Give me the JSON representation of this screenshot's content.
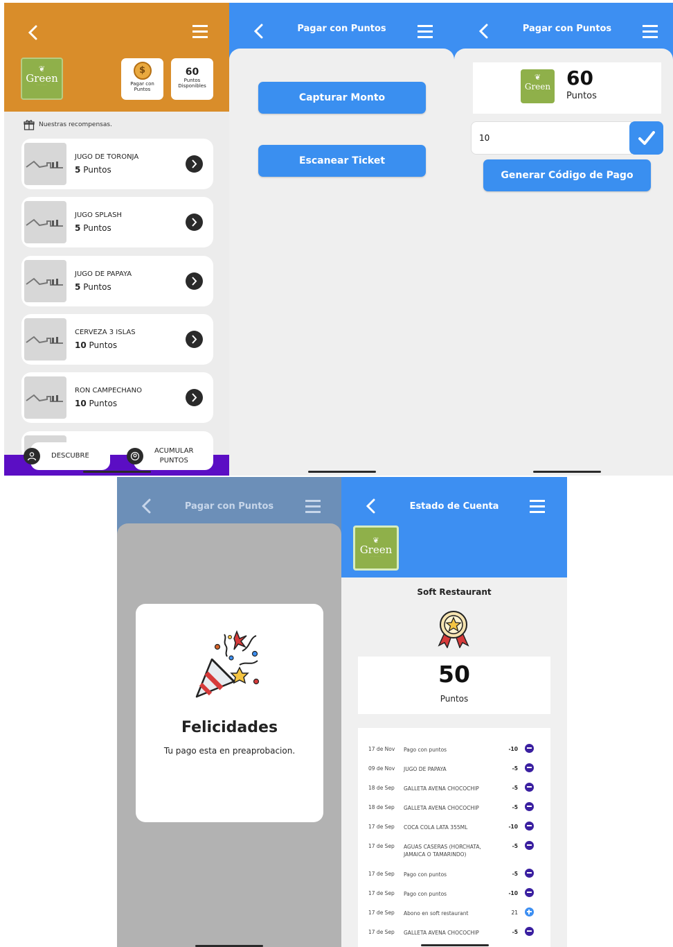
{
  "screen1": {
    "pay_card_label": "Pagar con Puntos",
    "points_value": "60",
    "points_label": "Puntos Disponibles",
    "rewards_title": "Nuestras recompensas.",
    "rewards": [
      {
        "name": "JUGO DE TORONJA",
        "points": "5",
        "unit": "Puntos"
      },
      {
        "name": "JUGO SPLASH",
        "points": "5",
        "unit": "Puntos"
      },
      {
        "name": "JUGO DE PAPAYA",
        "points": "5",
        "unit": "Puntos"
      },
      {
        "name": "CERVEZA 3 ISLAS",
        "points": "10",
        "unit": "Puntos"
      },
      {
        "name": "RON CAMPECHANO",
        "points": "10",
        "unit": "Puntos"
      }
    ],
    "tabs": {
      "discover": "DESCUBRE",
      "accumulate_line1": "ACUMULAR",
      "accumulate_line2": "PUNTOS"
    },
    "logo_text": "Green"
  },
  "screen2": {
    "title": "Pagar con Puntos",
    "capture_button": "Capturar Monto",
    "scan_button": "Escanear Ticket"
  },
  "screen3": {
    "title": "Pagar con Puntos",
    "balance_value": "60",
    "balance_label": "Puntos",
    "amount_value": "10",
    "generate_button": "Generar Código de Pago",
    "logo_text": "Green"
  },
  "screen4": {
    "title": "Pagar con Puntos",
    "modal_title": "Felicidades",
    "modal_text": "Tu pago esta en preaprobacion."
  },
  "screen5": {
    "title": "Estado de Cuenta",
    "logo_text": "Green",
    "restaurant_name": "Soft Restaurant",
    "points_value": "50",
    "points_label": "Puntos",
    "transactions": [
      {
        "date": "17 de Nov",
        "concept": "Pago con puntos",
        "amount": "-10",
        "kind": "minus"
      },
      {
        "date": "09 de Nov",
        "concept": "JUGO DE PAPAYA",
        "amount": "-5",
        "kind": "minus"
      },
      {
        "date": "18 de Sep",
        "concept": "GALLETA AVENA CHOCOCHIP",
        "amount": "-5",
        "kind": "minus"
      },
      {
        "date": "18 de Sep",
        "concept": "GALLETA AVENA CHOCOCHIP",
        "amount": "-5",
        "kind": "minus"
      },
      {
        "date": "17 de Sep",
        "concept": "COCA COLA LATA 355ML",
        "amount": "-10",
        "kind": "minus"
      },
      {
        "date": "17 de Sep",
        "concept": "AGUAS CASERAS (HORCHATA, JAMAICA O TAMARINDO)",
        "amount": "-5",
        "kind": "minus"
      },
      {
        "date": "17 de Sep",
        "concept": "Pago con puntos",
        "amount": "-5",
        "kind": "minus"
      },
      {
        "date": "17 de Sep",
        "concept": "Pago con puntos",
        "amount": "-10",
        "kind": "minus"
      },
      {
        "date": "17 de Sep",
        "concept": "Abono en soft restaurant",
        "amount": "21",
        "kind": "plus"
      },
      {
        "date": "17 de Sep",
        "concept": "GALLETA AVENA CHOCOCHIP",
        "amount": "-5",
        "kind": "minus"
      }
    ]
  },
  "colors": {
    "orange_header": "#d98d2a",
    "blue": "#3d8ff2",
    "purple": "#5b0ec4",
    "logo_green": "#8fb04a"
  }
}
